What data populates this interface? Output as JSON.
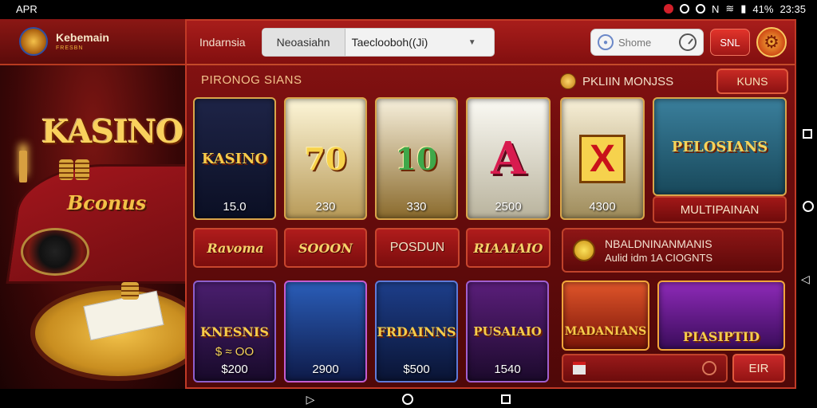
{
  "status": {
    "carrier": "APR",
    "battery": "41%",
    "time": "23:35"
  },
  "brand": {
    "name": "Kebemain",
    "sub": "FRESBN"
  },
  "promo": {
    "kasino": "KASINO",
    "bonus": "Bconus"
  },
  "topbar": {
    "region": "Indarnsia",
    "selector_left": "Neoasiahn",
    "selector_value": "Taeclooboh((Ji)",
    "search_placeholder": "Shome",
    "snl_label": "SNL"
  },
  "sections": {
    "games_title": "PIRONOG SIANS",
    "promo_title": "PKLIIN MONJSS",
    "kuns_label": "KUNS",
    "multi_label": "MULTIPAINAN",
    "banner_line1": "NBALDNINANMANIS",
    "banner_line2": "Aulid idm 1A CIOGNTS",
    "eir_label": "EIR"
  },
  "row1": [
    {
      "art": "KASINO",
      "value": "15.0"
    },
    {
      "art": "70",
      "value": "230"
    },
    {
      "art": "10",
      "value": "330"
    },
    {
      "art": "A",
      "value": "2500"
    },
    {
      "art": "X",
      "value": "4300"
    },
    {
      "art": "PELOSIANS",
      "value": ""
    }
  ],
  "bonus_row": [
    {
      "label": "Ravoma"
    },
    {
      "label": "SOOON"
    },
    {
      "label": "POSDUN"
    },
    {
      "label": "RIAAIAIO"
    }
  ],
  "row2": [
    {
      "art": "KNESNIS",
      "sub": "$ ≈ OO",
      "value": "$200"
    },
    {
      "art": "",
      "sub": "",
      "value": "2900"
    },
    {
      "art": "FRDAINNS",
      "sub": "",
      "value": "$500"
    },
    {
      "art": "PUSAIAIO",
      "sub": "",
      "value": "1540"
    },
    {
      "art": "MADANIANS",
      "sub": "",
      "value": ""
    },
    {
      "art": "PIASIPTID",
      "sub": "",
      "value": ""
    }
  ]
}
